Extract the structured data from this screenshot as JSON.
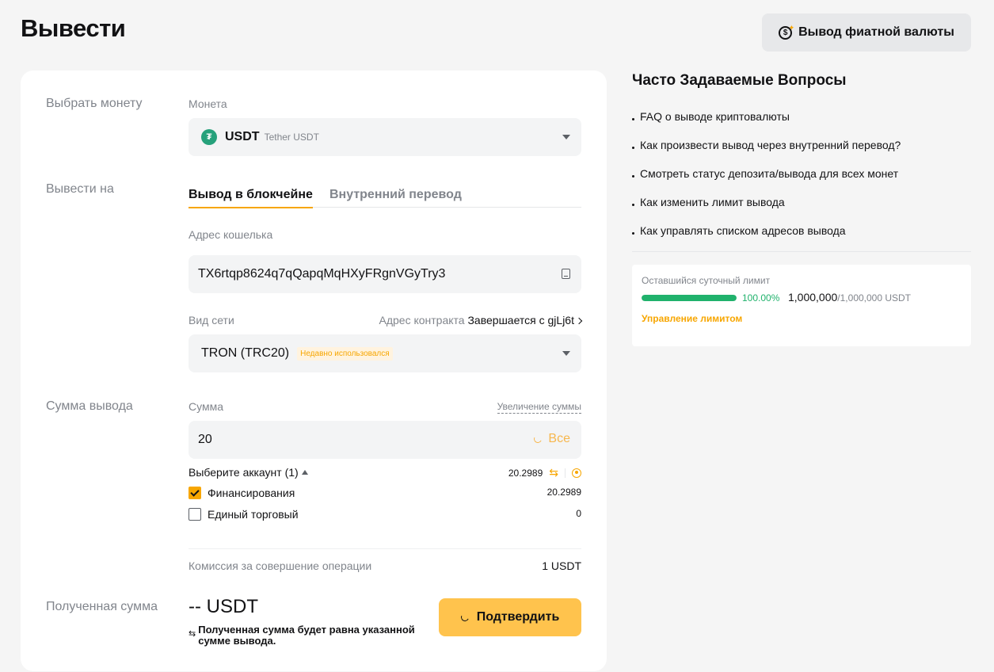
{
  "page": {
    "title": "Вывести",
    "fiat_button": "Вывод фиатной валюты"
  },
  "form": {
    "select_coin_label": "Выбрать монету",
    "coin_field_label": "Монета",
    "coin": {
      "code": "USDT",
      "name": "Tether USDT",
      "icon_glyph": "₮"
    },
    "withdraw_to_label": "Вывести на",
    "tabs": [
      {
        "label": "Вывод в блокчейне",
        "active": true
      },
      {
        "label": "Внутренний перевод",
        "active": false
      }
    ],
    "wallet_address_label": "Адрес кошелька",
    "wallet_address": "TX6rtqp8624q7qQapqMqHXyFRgnVGyTry3",
    "network_label": "Вид сети",
    "contract_label": "Адрес контракта",
    "contract_value": "Завершается с gjLj6t",
    "network": {
      "name": "TRON (TRC20)",
      "badge": "Недавно использовался"
    },
    "amount_section_label": "Сумма вывода",
    "amount_label": "Сумма",
    "increase_link": "Увеличение суммы",
    "amount_value": "20",
    "all_button": "Все",
    "account_title": "Выберите аккаунт (1)",
    "account_total": "20.2989",
    "accounts": [
      {
        "label": "Финансирования",
        "value": "20.2989",
        "checked": true
      },
      {
        "label": "Единый торговый",
        "value": "0",
        "checked": false
      }
    ],
    "fee_label": "Комиссия за совершение операции",
    "fee_value": "1 USDT",
    "received_label": "Полученная сумма",
    "received_amount": "-- USDT",
    "received_note": "Полученная сумма будет равна указанной сумме вывода.",
    "confirm_button": "Подтвердить"
  },
  "faq": {
    "title": "Часто Задаваемые Вопросы",
    "items": [
      "FAQ о выводе криптовалюты",
      "Как произвести вывод через внутренний перевод?",
      "Смотреть статус депозита/вывода для всех монет",
      "Как изменить лимит вывода",
      "Как управлять списком адресов вывода"
    ]
  },
  "limit": {
    "title": "Оставшийся суточный лимит",
    "percent_text": "100.00%",
    "fill_fraction": 1.0,
    "remaining": "1,000,000",
    "total": "/1,000,000 USDT",
    "manage_link": "Управление лимитом"
  },
  "colors": {
    "accent": "#f7a600",
    "button": "#ffc34d",
    "success": "#20b26c",
    "usdt": "#26a17b"
  }
}
